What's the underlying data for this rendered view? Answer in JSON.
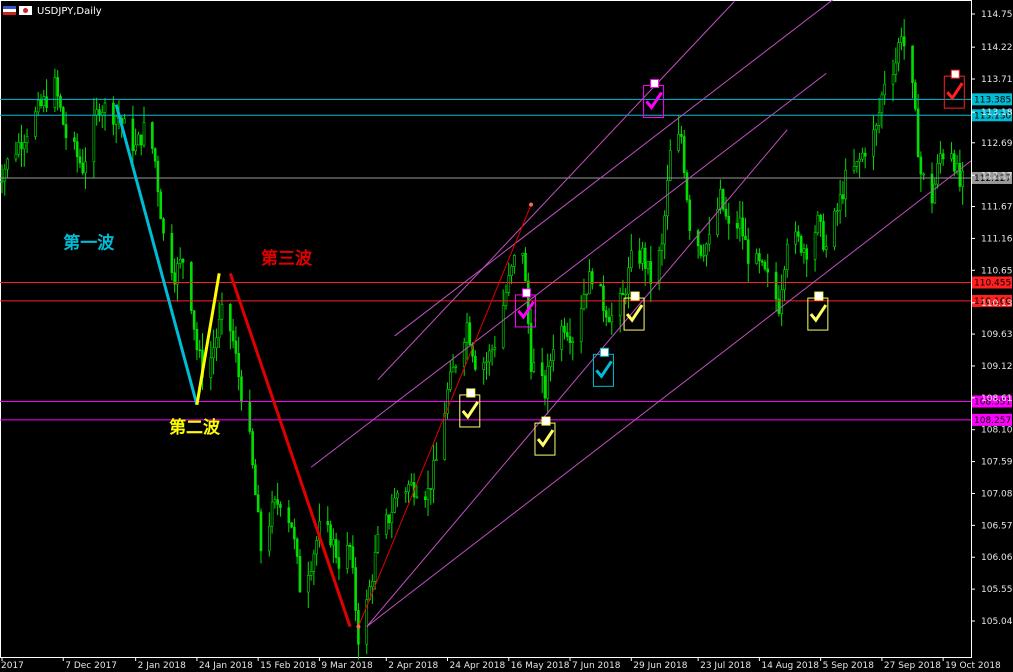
{
  "chart_data": {
    "type": "candlestick",
    "title": "USDJPY,Daily",
    "ylim": [
      104.4,
      114.9
    ],
    "y_ticks": [
      "114.750",
      "114.220",
      "113.710",
      "113.180",
      "112.690",
      "112.170",
      "111.670",
      "111.160",
      "110.650",
      "110.130",
      "109.630",
      "109.120",
      "108.610",
      "108.100",
      "107.590",
      "107.080",
      "106.570",
      "106.060",
      "105.550",
      "105.040"
    ],
    "x_ticks": [
      {
        "label": "2017",
        "date": "2017-11-15"
      },
      {
        "label": "7 Dec 2017",
        "date": "2017-12-07"
      },
      {
        "label": "2 Jan 2018",
        "date": "2018-01-02"
      },
      {
        "label": "24 Jan 2018",
        "date": "2018-01-24"
      },
      {
        "label": "15 Feb 2018",
        "date": "2018-02-15"
      },
      {
        "label": "9 Mar 2018",
        "date": "2018-03-09"
      },
      {
        "label": "2 Apr 2018",
        "date": "2018-04-02"
      },
      {
        "label": "24 Apr 2018",
        "date": "2018-04-24"
      },
      {
        "label": "16 May 2018",
        "date": "2018-05-16"
      },
      {
        "label": "7 Jun 2018",
        "date": "2018-06-07"
      },
      {
        "label": "29 Jun 2018",
        "date": "2018-06-29"
      },
      {
        "label": "23 Jul 2018",
        "date": "2018-07-23"
      },
      {
        "label": "14 Aug 2018",
        "date": "2018-08-14"
      },
      {
        "label": "5 Sep 2018",
        "date": "2018-09-05"
      },
      {
        "label": "27 Sep 2018",
        "date": "2018-09-27"
      },
      {
        "label": "19 Oct 2018",
        "date": "2018-10-19"
      }
    ],
    "price_path": [
      [
        "2017-11-12",
        112.0
      ],
      [
        "2017-11-20",
        112.6
      ],
      [
        "2017-11-28",
        113.2
      ],
      [
        "2017-12-04",
        113.6
      ],
      [
        "2017-12-08",
        112.8
      ],
      [
        "2017-12-14",
        112.3
      ],
      [
        "2017-12-20",
        113.3
      ],
      [
        "2017-12-27",
        113.1
      ],
      [
        "2018-01-02",
        112.6
      ],
      [
        "2018-01-06",
        113.0
      ],
      [
        "2018-01-09",
        112.4
      ],
      [
        "2018-01-12",
        111.2
      ],
      [
        "2018-01-16",
        110.6
      ],
      [
        "2018-01-20",
        110.9
      ],
      [
        "2018-01-24",
        109.4
      ],
      [
        "2018-01-27",
        108.9
      ],
      [
        "2018-01-31",
        109.6
      ],
      [
        "2018-02-03",
        110.1
      ],
      [
        "2018-02-06",
        109.5
      ],
      [
        "2018-02-09",
        108.7
      ],
      [
        "2018-02-12",
        107.9
      ],
      [
        "2018-02-16",
        106.2
      ],
      [
        "2018-02-20",
        106.8
      ],
      [
        "2018-02-23",
        107.0
      ],
      [
        "2018-02-27",
        106.6
      ],
      [
        "2018-03-02",
        105.6
      ],
      [
        "2018-03-06",
        106.0
      ],
      [
        "2018-03-09",
        106.5
      ],
      [
        "2018-03-13",
        106.4
      ],
      [
        "2018-03-16",
        106.0
      ],
      [
        "2018-03-20",
        106.2
      ],
      [
        "2018-03-23",
        104.8
      ],
      [
        "2018-03-26",
        105.3
      ],
      [
        "2018-03-30",
        106.3
      ],
      [
        "2018-04-03",
        106.7
      ],
      [
        "2018-04-06",
        107.1
      ],
      [
        "2018-04-10",
        107.2
      ],
      [
        "2018-04-13",
        107.2
      ],
      [
        "2018-04-17",
        107.1
      ],
      [
        "2018-04-20",
        107.6
      ],
      [
        "2018-04-24",
        108.7
      ],
      [
        "2018-04-27",
        109.2
      ],
      [
        "2018-05-01",
        109.8
      ],
      [
        "2018-05-04",
        109.2
      ],
      [
        "2018-05-08",
        109.2
      ],
      [
        "2018-05-11",
        109.5
      ],
      [
        "2018-05-15",
        110.3
      ],
      [
        "2018-05-18",
        110.8
      ],
      [
        "2018-05-21",
        111.0
      ],
      [
        "2018-05-24",
        109.2
      ],
      [
        "2018-05-29",
        108.7
      ],
      [
        "2018-06-01",
        109.5
      ],
      [
        "2018-06-05",
        109.8
      ],
      [
        "2018-06-08",
        109.6
      ],
      [
        "2018-06-12",
        110.3
      ],
      [
        "2018-06-15",
        110.6
      ],
      [
        "2018-06-19",
        110.1
      ],
      [
        "2018-06-22",
        109.9
      ],
      [
        "2018-06-26",
        110.2
      ],
      [
        "2018-06-29",
        110.8
      ],
      [
        "2018-07-03",
        110.9
      ],
      [
        "2018-07-06",
        110.5
      ],
      [
        "2018-07-10",
        111.0
      ],
      [
        "2018-07-13",
        112.5
      ],
      [
        "2018-07-17",
        112.8
      ],
      [
        "2018-07-20",
        111.4
      ],
      [
        "2018-07-24",
        111.0
      ],
      [
        "2018-07-27",
        111.1
      ],
      [
        "2018-07-31",
        111.8
      ],
      [
        "2018-08-03",
        111.3
      ],
      [
        "2018-08-07",
        111.4
      ],
      [
        "2018-08-10",
        110.9
      ],
      [
        "2018-08-14",
        110.7
      ],
      [
        "2018-08-17",
        110.5
      ],
      [
        "2018-08-21",
        110.1
      ],
      [
        "2018-08-24",
        111.2
      ],
      [
        "2018-08-28",
        111.1
      ],
      [
        "2018-08-31",
        111.0
      ],
      [
        "2018-09-04",
        111.4
      ],
      [
        "2018-09-07",
        111.0
      ],
      [
        "2018-09-11",
        111.6
      ],
      [
        "2018-09-14",
        112.1
      ],
      [
        "2018-09-18",
        112.3
      ],
      [
        "2018-09-21",
        112.6
      ],
      [
        "2018-09-25",
        112.9
      ],
      [
        "2018-09-28",
        113.7
      ],
      [
        "2018-10-02",
        114.0
      ],
      [
        "2018-10-04",
        114.5
      ],
      [
        "2018-10-08",
        113.5
      ],
      [
        "2018-10-11",
        112.2
      ],
      [
        "2018-10-15",
        111.8
      ],
      [
        "2018-10-18",
        112.5
      ],
      [
        "2018-10-22",
        112.6
      ],
      [
        "2018-10-25",
        112.0
      ],
      [
        "2018-10-28",
        112.2
      ]
    ],
    "hlines": [
      {
        "price": 113.385,
        "label": "113.385",
        "color": "#00bcd4"
      },
      {
        "price": 113.13,
        "label": "113.130",
        "color": "#00bcd4"
      },
      {
        "price": 112.127,
        "label": "112.127",
        "color": "#9a9a9a"
      },
      {
        "price": 110.455,
        "label": "110.455",
        "color": "#ff2020"
      },
      {
        "price": 110.16,
        "label": "110.160",
        "color": "#ff2020"
      },
      {
        "price": 108.551,
        "label": "108.551",
        "color": "#ff00ff"
      },
      {
        "price": 108.257,
        "label": "108.257",
        "color": "#ff00ff"
      }
    ],
    "wave_lines": [
      {
        "color": "#00bcd4",
        "from": [
          "2017-12-26",
          113.3
        ],
        "to": [
          "2018-01-24",
          108.5
        ]
      },
      {
        "color": "#ffff00",
        "from": [
          "2018-01-24",
          108.5
        ],
        "to": [
          "2018-02-01",
          110.6
        ]
      },
      {
        "color": "#e00000",
        "from": [
          "2018-02-05",
          110.6
        ],
        "to": [
          "2018-03-20",
          104.95
        ]
      },
      {
        "color": "#e00000",
        "from": [
          "2018-03-23",
          104.95
        ],
        "to": [
          "2018-05-24",
          111.7
        ]
      }
    ],
    "channel_lines": [
      {
        "from": [
          "2018-03-26",
          104.95
        ],
        "to": [
          "2018-10-29",
          112.4
        ]
      },
      {
        "from": [
          "2018-03-26",
          104.95
        ],
        "to": [
          "2018-08-24",
          112.9
        ]
      },
      {
        "from": [
          "2018-03-06",
          107.5
        ],
        "to": [
          "2018-09-07",
          113.8
        ]
      },
      {
        "from": [
          "2018-04-05",
          109.6
        ],
        "to": [
          "2018-09-10",
          115.0
        ]
      },
      {
        "from": [
          "2018-03-30",
          108.9
        ],
        "to": [
          "2018-08-05",
          114.95
        ]
      }
    ],
    "wave_labels": [
      {
        "text": "第一波",
        "color": "#00bcd4",
        "at": [
          "2017-12-07",
          111.0
        ]
      },
      {
        "text": "第二波",
        "color": "#ffff00",
        "at": [
          "2018-01-14",
          108.05
        ]
      },
      {
        "text": "第三波",
        "color": "#e00000",
        "at": [
          "2018-02-16",
          110.75
        ]
      }
    ],
    "signals": [
      {
        "color": "#ff00ff",
        "at": [
          "2018-05-22",
          110.0
        ]
      },
      {
        "color": "#ffff66",
        "at": [
          "2018-05-02",
          108.4
        ]
      },
      {
        "color": "#ffff66",
        "at": [
          "2018-05-29",
          107.95
        ]
      },
      {
        "color": "#00bcd4",
        "at": [
          "2018-06-19",
          109.05
        ]
      },
      {
        "color": "#ffff66",
        "at": [
          "2018-06-30",
          109.95
        ]
      },
      {
        "color": "#ff00ff",
        "at": [
          "2018-07-07",
          113.35
        ]
      },
      {
        "color": "#ffff66",
        "at": [
          "2018-09-04",
          109.95
        ]
      },
      {
        "color": "#ff2020",
        "at": [
          "2018-10-23",
          113.5
        ]
      }
    ]
  }
}
